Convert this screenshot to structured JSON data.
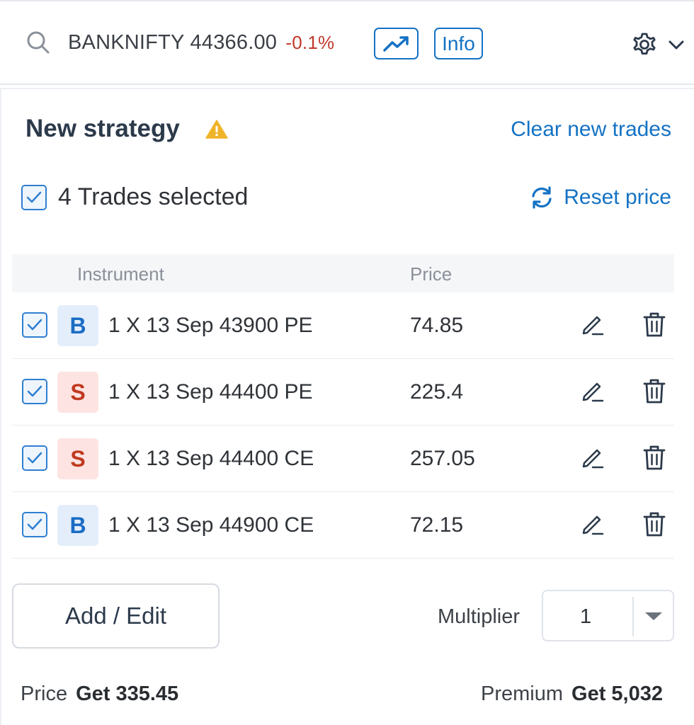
{
  "header": {
    "symbol": "BANKNIFTY",
    "ltp": "44366.00",
    "change": "-0.1%",
    "info_label": "Info",
    "icons": [
      "search-icon",
      "trend-chart-icon",
      "gear-icon",
      "chevron-down-icon"
    ]
  },
  "strategy": {
    "title": "New strategy",
    "clear_label": "Clear new trades",
    "selected_label": "4 Trades selected",
    "reset_label": "Reset price"
  },
  "table": {
    "columns": [
      "Instrument",
      "Price"
    ],
    "rows": [
      {
        "side": "B",
        "instrument": "1 X 13 Sep 43900 PE",
        "price": "74.85"
      },
      {
        "side": "S",
        "instrument": "1 X 13 Sep 44400 PE",
        "price": "225.4"
      },
      {
        "side": "S",
        "instrument": "1 X 13 Sep 44400 CE",
        "price": "257.05"
      },
      {
        "side": "B",
        "instrument": "1 X 13 Sep 44900 CE",
        "price": "72.15"
      }
    ]
  },
  "footer": {
    "add_edit_label": "Add / Edit",
    "multiplier_label": "Multiplier",
    "multiplier_value": "1",
    "price_label": "Price",
    "price_value": "Get 335.45",
    "premium_label": "Premium",
    "premium_value": "Get 5,032"
  },
  "colors": {
    "accent": "#1472c4",
    "negative": "#c0392b",
    "buy_bg": "#e4eefb",
    "sell_bg": "#fde4e2",
    "warning": "#f0b429"
  }
}
